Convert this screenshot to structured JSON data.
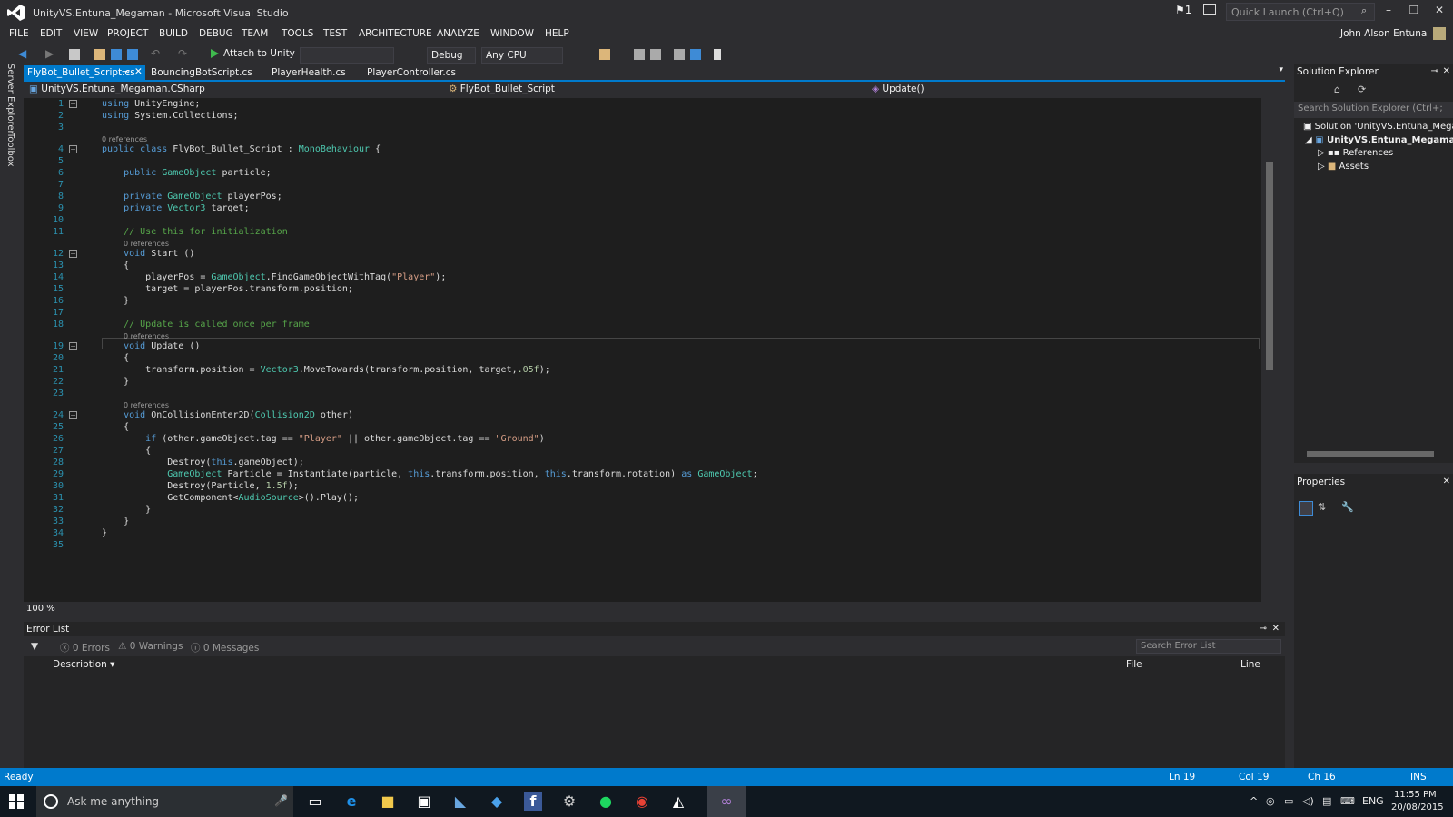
{
  "window": {
    "title": "UnityVS.Entuna_Megaman - Microsoft Visual Studio",
    "notification_count": "1",
    "quick_launch_placeholder": "Quick Launch (Ctrl+Q)"
  },
  "menu": [
    "FILE",
    "EDIT",
    "VIEW",
    "PROJECT",
    "BUILD",
    "DEBUG",
    "TEAM",
    "TOOLS",
    "TEST",
    "ARCHITECTURE",
    "ANALYZE",
    "WINDOW",
    "HELP"
  ],
  "user": {
    "name": "John Alson Entuna"
  },
  "toolbar": {
    "attach_label": "Attach to Unity",
    "config": "Debug",
    "platform": "Any CPU"
  },
  "side_tabs": [
    "Server Explorer",
    "Toolbox"
  ],
  "doc_tabs": [
    {
      "label": "FlyBot_Bullet_Script.cs",
      "active": true
    },
    {
      "label": "BouncingBotScript.cs",
      "active": false
    },
    {
      "label": "PlayerHealth.cs",
      "active": false
    },
    {
      "label": "PlayerController.cs",
      "active": false
    }
  ],
  "nav": {
    "project": "UnityVS.Entuna_Megaman.CSharp",
    "class": "FlyBot_Bullet_Script",
    "member": "Update()"
  },
  "editor": {
    "zoom": "100 %",
    "refs_label": "0 references",
    "lines": [
      "using UnityEngine;",
      "using System.Collections;",
      "",
      "public class FlyBot_Bullet_Script : MonoBehaviour {",
      "",
      "    public GameObject particle;",
      "",
      "    private GameObject playerPos;",
      "    private Vector3 target;",
      "",
      "    // Use this for initialization",
      "    void Start ()",
      "    {",
      "        playerPos = GameObject.FindGameObjectWithTag(\"Player\");",
      "        target = playerPos.transform.position;",
      "    }",
      "",
      "    // Update is called once per frame",
      "    void Update ()",
      "    {",
      "        transform.position = Vector3.MoveTowards(transform.position, target,.05f);",
      "    }",
      "",
      "    void OnCollisionEnter2D(Collision2D other)",
      "    {",
      "        if (other.gameObject.tag == \"Player\" || other.gameObject.tag == \"Ground\")",
      "        {",
      "            Destroy(this.gameObject);",
      "            GameObject Particle = Instantiate(particle, this.transform.position, this.transform.rotation) as GameObject;",
      "            Destroy(Particle, 1.5f);",
      "            GetComponent<AudioSource>().Play();",
      "        }",
      "    }",
      "}",
      ""
    ]
  },
  "error_list": {
    "title": "Error List",
    "errors": "0 Errors",
    "warnings": "0 Warnings",
    "messages": "0 Messages",
    "search_placeholder": "Search Error List",
    "columns": [
      "Description",
      "File",
      "Line"
    ]
  },
  "solution_explorer": {
    "title": "Solution Explorer",
    "search_placeholder": "Search Solution Explorer (Ctrl+;",
    "items": [
      "Solution 'UnityVS.Entuna_Megar",
      "UnityVS.Entuna_Megaman.C",
      "References",
      "Assets"
    ]
  },
  "properties": {
    "title": "Properties"
  },
  "status": {
    "state": "Ready",
    "ln": "Ln 19",
    "col": "Col 19",
    "ch": "Ch 16",
    "mode": "INS"
  },
  "taskbar": {
    "search_placeholder": "Ask me anything",
    "lang": "ENG",
    "time": "11:55 PM",
    "date": "20/08/2015"
  },
  "colors": {
    "accent": "#007acc",
    "editor_bg": "#1e1e1e",
    "chrome_bg": "#2d2d30"
  }
}
